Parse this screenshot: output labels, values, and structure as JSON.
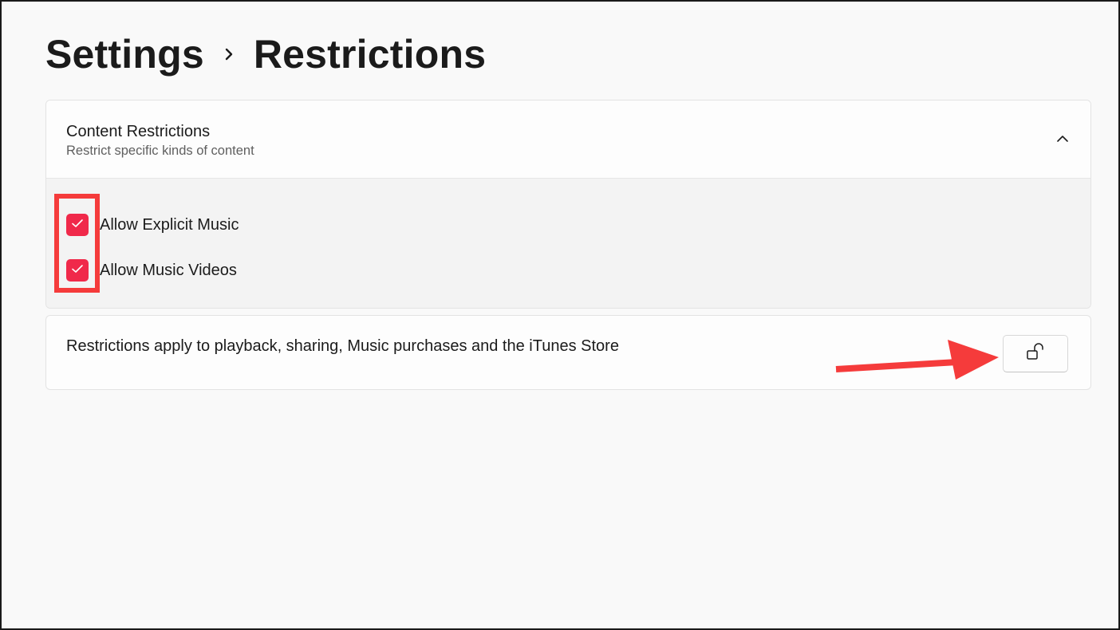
{
  "breadcrumb": {
    "parent": "Settings",
    "current": "Restrictions",
    "separator_icon": "chevron-right-icon"
  },
  "content_restrictions": {
    "title": "Content Restrictions",
    "subtitle": "Restrict specific kinds of content",
    "expanded": true,
    "collapse_icon": "chevron-up-icon",
    "options": [
      {
        "label": "Allow Explicit Music",
        "checked": true
      },
      {
        "label": "Allow Music Videos",
        "checked": true
      }
    ]
  },
  "info": {
    "text": "Restrictions apply to playback, sharing, Music purchases and the iTunes Store",
    "lock_icon": "unlocked-padlock-icon"
  },
  "annotations": {
    "highlight_color": "#f53b3b",
    "arrow_color": "#f53b3b"
  },
  "colors": {
    "accent": "#f0294a",
    "background": "#f9f9f9"
  }
}
